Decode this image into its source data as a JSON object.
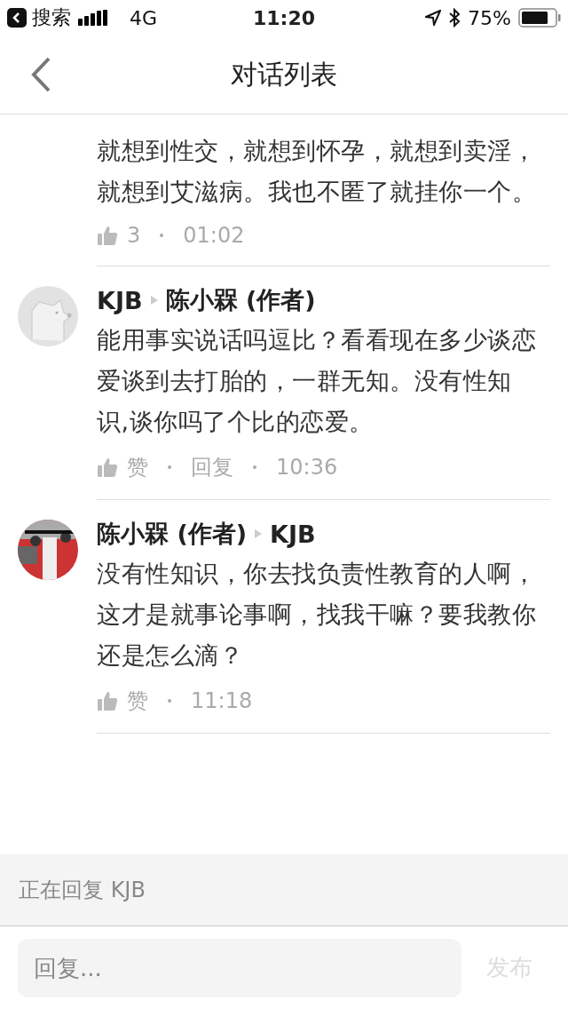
{
  "status_bar": {
    "back_app": "搜索",
    "network": "4G",
    "time": "11:20",
    "battery_text": "75%"
  },
  "header": {
    "title": "对话列表"
  },
  "comments": [
    {
      "text": "就想到性交，就想到怀孕，就想到卖淫，就想到艾滋病。我也不匿了就挂你一个。",
      "likes": "3",
      "time": "01:02"
    },
    {
      "author": "KJB",
      "target": "陈小槑 (作者)",
      "text": "能用事实说话吗逗比？看看现在多少谈恋爱谈到去打胎的，一群无知。没有性知识,谈你吗了个比的恋爱。",
      "likes": "赞",
      "reply": "回复",
      "time": "10:36"
    },
    {
      "author": "陈小槑 (作者)",
      "target": "KJB",
      "text": "没有性知识，你去找负责性教育的人啊，这才是就事论事啊，找我干嘛？要我教你还是怎么滴？",
      "likes": "赞",
      "time": "11:18"
    }
  ],
  "reply_bar": {
    "label": "正在回复 KJB"
  },
  "composer": {
    "placeholder": "回复...",
    "submit": "发布",
    "disabled": true
  }
}
